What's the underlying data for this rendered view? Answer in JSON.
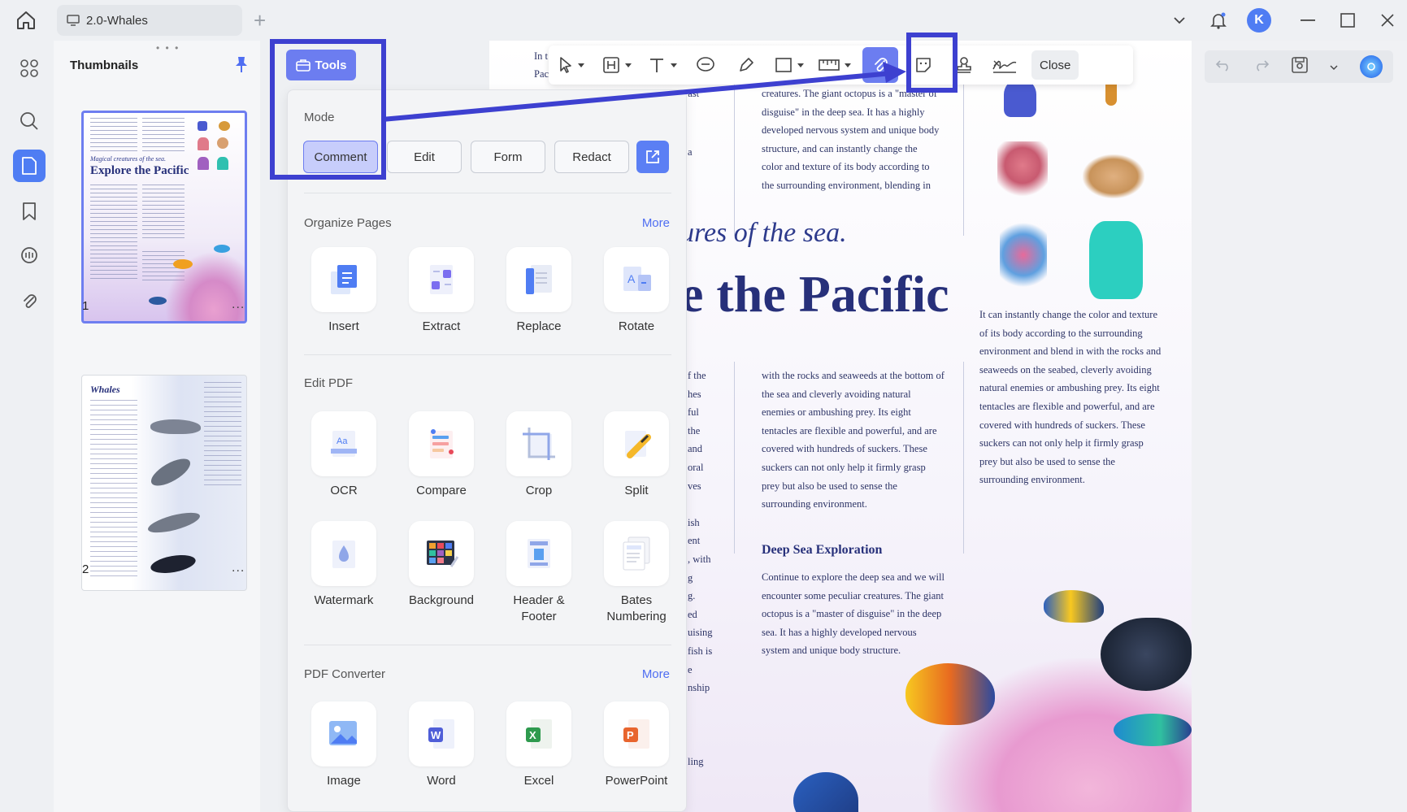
{
  "titlebar": {
    "tab_title": "2.0-Whales",
    "avatar_initial": "K"
  },
  "thumbnails": {
    "title": "Thumbnails",
    "pages": [
      {
        "number": "1",
        "heading_small": "Magical creatures of the sea.",
        "heading": "Explore the Pacific"
      },
      {
        "number": "2",
        "heading": "Whales"
      }
    ],
    "more_dots": "..."
  },
  "annotation_toolbar": {
    "close_label": "Close"
  },
  "tools_chip": {
    "label": "Tools"
  },
  "tools_panel": {
    "mode_label": "Mode",
    "modes": [
      "Comment",
      "Edit",
      "Form",
      "Redact"
    ],
    "selected_mode": "Comment",
    "organize": {
      "title": "Organize Pages",
      "more": "More",
      "items": [
        "Insert",
        "Extract",
        "Replace",
        "Rotate"
      ]
    },
    "edit_pdf": {
      "title": "Edit PDF",
      "items": [
        "OCR",
        "Compare",
        "Crop",
        "Split",
        "Watermark",
        "Background",
        "Header & Footer",
        "Bates Numbering"
      ]
    },
    "converter": {
      "title": "PDF Converter",
      "more": "More",
      "items": [
        "Image",
        "Word",
        "Excel",
        "PowerPoint"
      ]
    }
  },
  "document": {
    "heading_italic": "ures of the sea.",
    "heading": "e the Pacific",
    "top_col_fragment_1": "In t",
    "top_col_fragment_2": "Pac",
    "top_col_fragment_3": "vast",
    "top_col_fragment_4": "a",
    "col2_top": "creatures. The giant octopus is a \"master of disguise\" in the deep sea. It has a highly developed nervous system and unique body structure, and can instantly change the color and texture of its body according to the surrounding environment, blending in",
    "col2_mid": "with the rocks and seaweeds at the bottom of the sea and cleverly avoiding natural enemies or ambushing prey. Its eight tentacles are flexible and powerful, and are covered with hundreds of suckers. These suckers can not only help it firmly grasp prey but also be used to sense the surrounding environment.",
    "col3_mid": "It can instantly change the color and texture of its body according to the surrounding environment and blend in with the rocks and seaweeds on the seabed, cleverly avoiding natural enemies or ambushing prey. Its eight tentacles are flexible and powerful, and are covered with hundreds of suckers. These suckers can not only help it firmly grasp prey but also be used to sense the surrounding environment.",
    "deep_sea_title": "Deep Sea Exploration",
    "deep_sea_text": "Continue to explore the deep sea and we will encounter some peculiar creatures. The giant octopus is a \"master of disguise\" in the deep sea. It has a highly developed nervous system and unique body structure.",
    "left_fragments": [
      "f the",
      "hes",
      "ful",
      "the",
      "and",
      "oral",
      "ves",
      "",
      "ish",
      "ent",
      ", with",
      "g",
      "g.",
      "ed",
      "uising",
      "fish is",
      "e",
      "nship",
      "",
      "",
      "",
      "ling"
    ]
  },
  "colors": {
    "accent": "#6c7df0",
    "highlight": "#3d40d0",
    "heading": "#27307a",
    "active_rail": "#4f7df3"
  }
}
